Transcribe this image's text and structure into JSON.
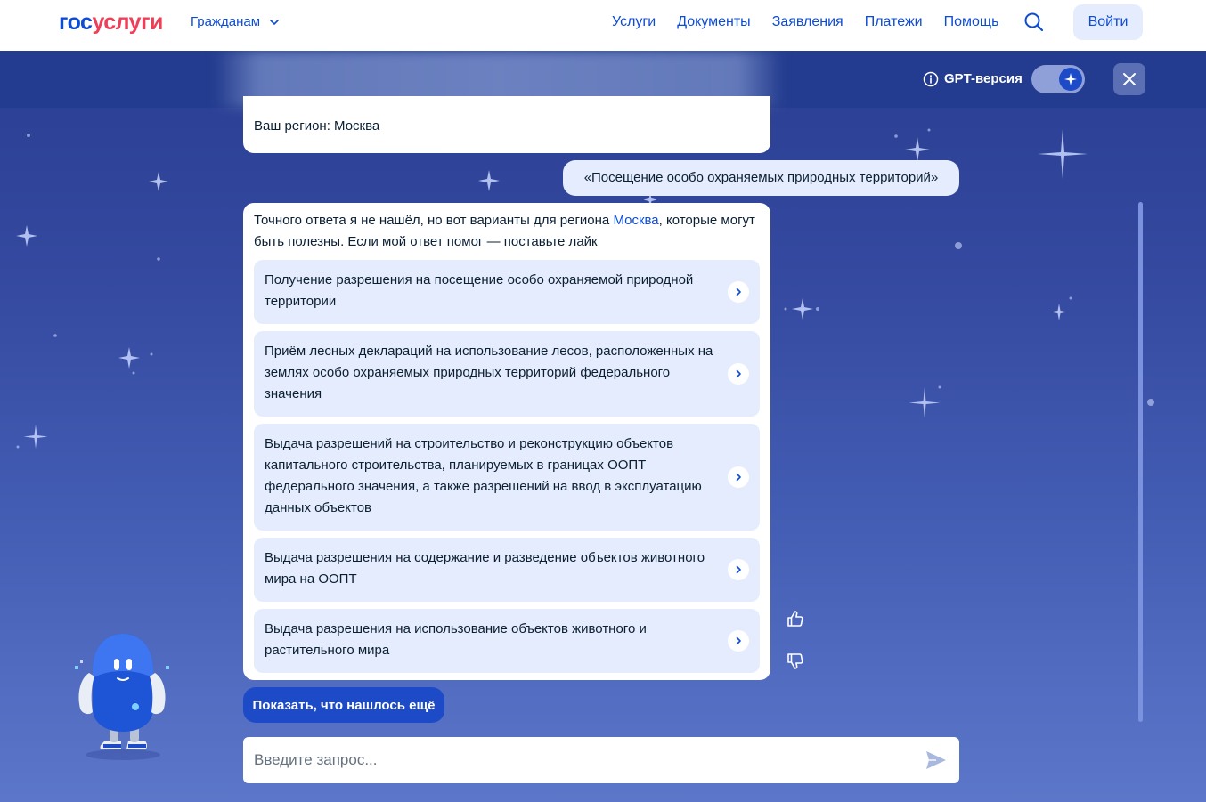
{
  "header": {
    "logo_part1": "гос",
    "logo_part2": "услуги",
    "citizens_menu": "Гражданам",
    "nav": [
      "Услуги",
      "Документы",
      "Заявления",
      "Платежи",
      "Помощь"
    ],
    "login_label": "Войти"
  },
  "chat_header": {
    "gpt_label": "GPT-версия",
    "gpt_enabled": true
  },
  "messages": {
    "region_text": "Ваш регион: Москва",
    "user_query": "«Посещение особо охраняемых природных территорий»",
    "answer_intro_1": "Точного ответа я не нашёл, но вот варианты для региона ",
    "answer_region": "Москва",
    "answer_intro_2": ", которые могут быть полезны. Если мой ответ помог — поставьте лайк",
    "options": [
      "Получение разрешения на посещение особо охраняемой природной территории",
      "Приём лесных деклараций на использование лесов, расположенных на землях особо охраняемых природных территорий федерального значения",
      "Выдача разрешений на строительство и реконструкцию объектов капитального строительства, планируемых в границах ООПТ федерального значения, а также разрешений на ввод в эксплуатацию данных объектов",
      "Выдача разрешения на содержание и разведение объектов животного мира на ООПТ",
      "Выдача разрешения на использование объектов животного и растительного мира"
    ]
  },
  "more_button": "Показать, что нашлось ещё",
  "input": {
    "placeholder": "Введите запрос...",
    "value": ""
  },
  "colors": {
    "brand_blue": "#0d4cd3",
    "brand_red": "#ee3f58",
    "chat_bg_top": "#2a3f93",
    "chat_bg_bottom": "#5c77c9",
    "option_bg": "#e4ecfd",
    "primary_button": "#1d4bc8"
  },
  "icons": [
    "chevron-down-icon",
    "search-icon",
    "info-icon",
    "sparkle-icon",
    "close-icon",
    "chevron-right-icon",
    "thumbs-up-icon",
    "thumbs-down-icon",
    "send-icon"
  ]
}
